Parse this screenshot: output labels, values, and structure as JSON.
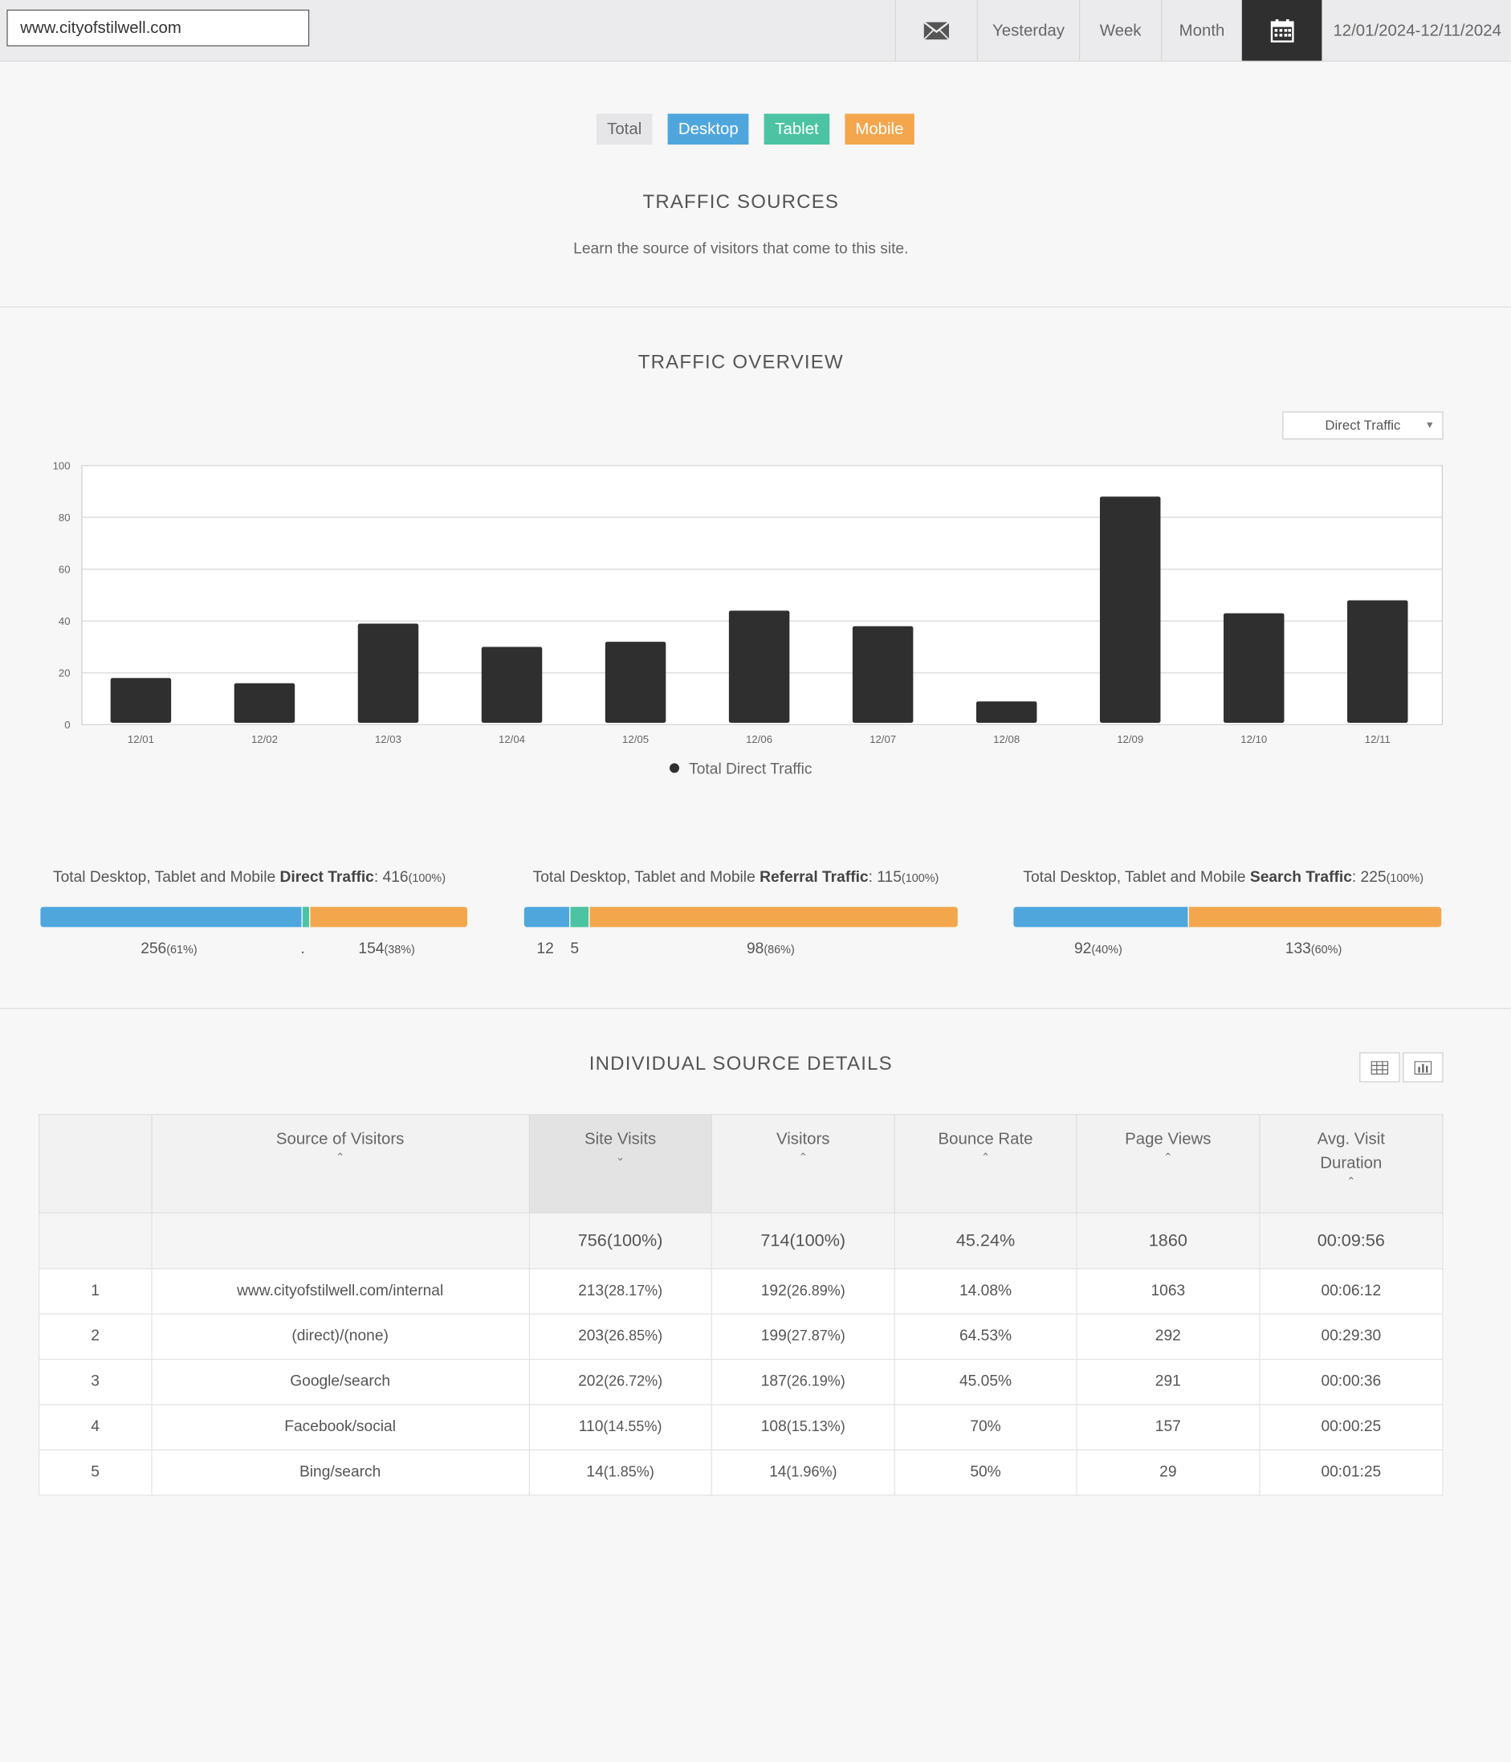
{
  "header": {
    "site": "www.cityofstilwell.com",
    "tabs": {
      "yesterday": "Yesterday",
      "week": "Week",
      "month": "Month"
    },
    "date_range": "12/01/2024-12/11/2024"
  },
  "filters": {
    "total": "Total",
    "desktop": "Desktop",
    "tablet": "Tablet",
    "mobile": "Mobile"
  },
  "traffic_sources": {
    "title": "TRAFFIC  SOURCES",
    "subtitle": "Learn the source of visitors that come to this site."
  },
  "overview": {
    "title": "TRAFFIC  OVERVIEW",
    "selector": "Direct Traffic",
    "legend": "Total Direct Traffic"
  },
  "chart_data": {
    "type": "bar",
    "categories": [
      "12/01",
      "12/02",
      "12/03",
      "12/04",
      "12/05",
      "12/06",
      "12/07",
      "12/08",
      "12/09",
      "12/10",
      "12/11"
    ],
    "series": [
      {
        "name": "Total Direct Traffic",
        "values": [
          18,
          16,
          39,
          30,
          32,
          44,
          38,
          9,
          88,
          43,
          48
        ]
      }
    ],
    "ylim": [
      0,
      100
    ],
    "yticks": [
      0,
      20,
      40,
      60,
      80,
      100
    ],
    "grid": true,
    "legend": "bottom",
    "bar_color": "#2f2f2f"
  },
  "breakdown": [
    {
      "prefix": "Total Desktop, Tablet and Mobile ",
      "kind": "Direct Traffic",
      "total": ": 416",
      "pct": "(100%)",
      "desktop": 256,
      "tablet": 6,
      "mobile": 154,
      "labels": {
        "d": "256",
        "dp": "(61%)",
        "t": ".",
        "m": "154",
        "mp": "(38%)"
      }
    },
    {
      "prefix": "Total Desktop, Tablet and Mobile ",
      "kind": "Referral Traffic",
      "total": ": 115",
      "pct": "(100%)",
      "desktop": 12,
      "tablet": 5,
      "mobile": 98,
      "labels": {
        "d": "12",
        "t": "5",
        "m": "98",
        "mp": "(86%)"
      }
    },
    {
      "prefix": "Total Desktop, Tablet and Mobile ",
      "kind": "Search Traffic",
      "total": ": 225",
      "pct": "(100%)",
      "desktop": 92,
      "tablet": 0,
      "mobile": 133,
      "labels": {
        "d": "92",
        "dp": "(40%)",
        "m": "133",
        "mp": "(60%)"
      }
    }
  ],
  "details": {
    "title": "INDIVIDUAL  SOURCE  DETAILS",
    "columns": [
      "Source of Visitors",
      "Site Visits",
      "Visitors",
      "Bounce Rate",
      "Page Views",
      "Avg. Visit",
      "Duration"
    ],
    "totals": {
      "visits": "756(100%)",
      "visitors": "714(100%)",
      "bounce": "45.24%",
      "views": "1860",
      "duration": "00:09:56"
    },
    "rows": [
      {
        "n": "1",
        "source": "www.cityofstilwell.com/internal",
        "visits": "213",
        "visits_p": "(28.17%)",
        "visitors": "192",
        "visitors_p": "(26.89%)",
        "bounce": "14.08%",
        "views": "1063",
        "duration": "00:06:12"
      },
      {
        "n": "2",
        "source": "(direct)/(none)",
        "visits": "203",
        "visits_p": "(26.85%)",
        "visitors": "199",
        "visitors_p": "(27.87%)",
        "bounce": "64.53%",
        "views": "292",
        "duration": "00:29:30"
      },
      {
        "n": "3",
        "source": "Google/search",
        "visits": "202",
        "visits_p": "(26.72%)",
        "visitors": "187",
        "visitors_p": "(26.19%)",
        "bounce": "45.05%",
        "views": "291",
        "duration": "00:00:36"
      },
      {
        "n": "4",
        "source": "Facebook/social",
        "visits": "110",
        "visits_p": "(14.55%)",
        "visitors": "108",
        "visitors_p": "(15.13%)",
        "bounce": "70%",
        "views": "157",
        "duration": "00:00:25"
      },
      {
        "n": "5",
        "source": "Bing/search",
        "visits": "14",
        "visits_p": "(1.85%)",
        "visitors": "14",
        "visitors_p": "(1.96%)",
        "bounce": "50%",
        "views": "29",
        "duration": "00:01:25"
      }
    ]
  }
}
